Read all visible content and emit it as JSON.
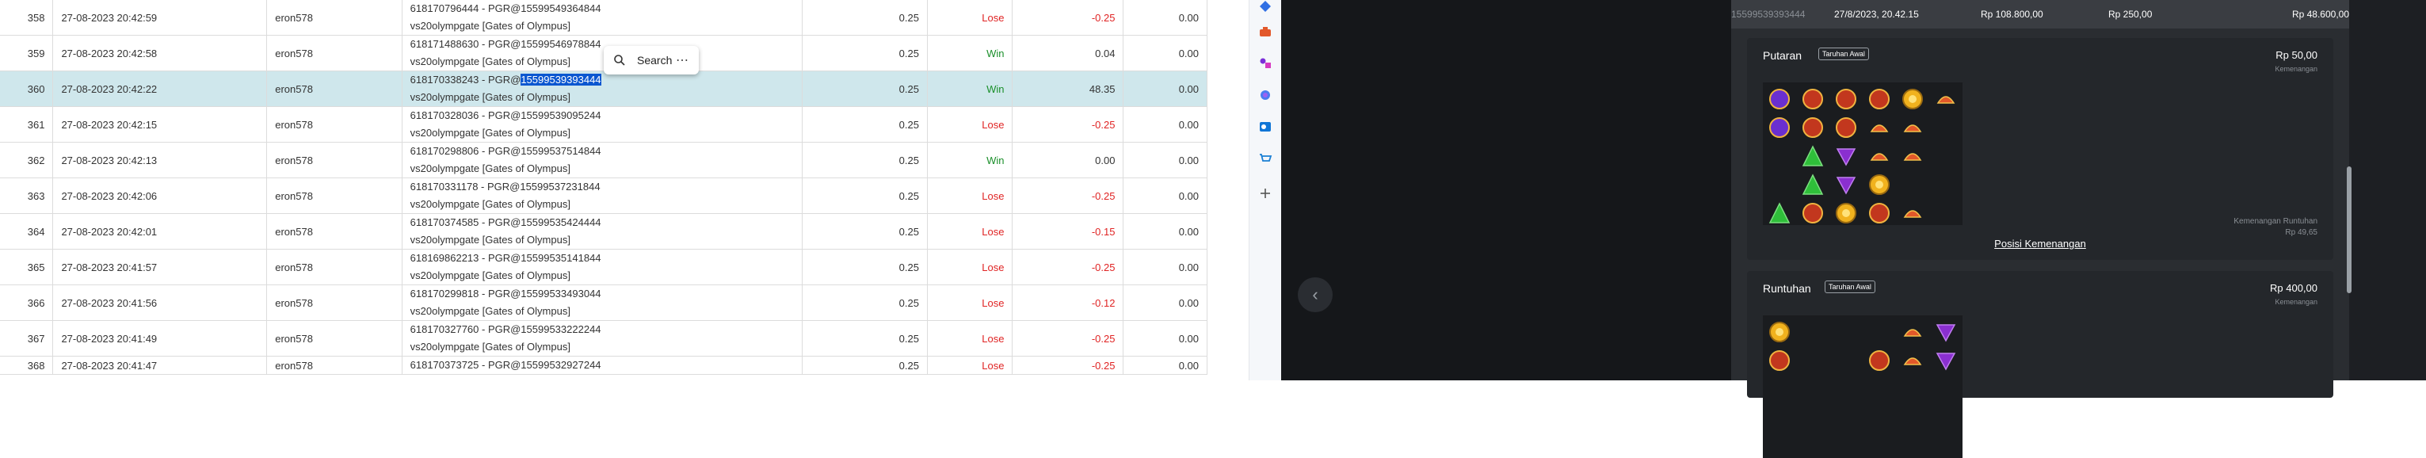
{
  "table": {
    "rows": [
      {
        "no": "358",
        "datetime": "27-08-2023 20:42:59",
        "user": "eron578",
        "tx_line1": "618170796444 - PGR@15599549364844",
        "tx_line2": "vs20olympgate [Gates of Olympus]",
        "bet": "0.25",
        "result": "Lose",
        "winloss": "-0.25",
        "extra": "0.00"
      },
      {
        "no": "359",
        "datetime": "27-08-2023 20:42:58",
        "user": "eron578",
        "tx_line1": "618171488630 - PGR@15599546978844",
        "tx_line2": "vs20olympgate [Gates of Olympus]",
        "bet": "0.25",
        "result": "Win",
        "winloss": "0.04",
        "extra": "0.00"
      },
      {
        "no": "360",
        "datetime": "27-08-2023 20:42:22",
        "user": "eron578",
        "tx_prefix": "618170338243 - PGR@",
        "tx_highlight": "15599539393444",
        "tx_line2": "vs20olympgate [Gates of Olympus]",
        "bet": "0.25",
        "result": "Win",
        "winloss": "48.35",
        "extra": "0.00"
      },
      {
        "no": "361",
        "datetime": "27-08-2023 20:42:15",
        "user": "eron578",
        "tx_line1": "618170328036 - PGR@15599539095244",
        "tx_line2": "vs20olympgate [Gates of Olympus]",
        "bet": "0.25",
        "result": "Lose",
        "winloss": "-0.25",
        "extra": "0.00"
      },
      {
        "no": "362",
        "datetime": "27-08-2023 20:42:13",
        "user": "eron578",
        "tx_line1": "618170298806 - PGR@15599537514844",
        "tx_line2": "vs20olympgate [Gates of Olympus]",
        "bet": "0.25",
        "result": "Win",
        "winloss": "0.00",
        "extra": "0.00"
      },
      {
        "no": "363",
        "datetime": "27-08-2023 20:42:06",
        "user": "eron578",
        "tx_line1": "618170331178 - PGR@15599537231844",
        "tx_line2": "vs20olympgate [Gates of Olympus]",
        "bet": "0.25",
        "result": "Lose",
        "winloss": "-0.25",
        "extra": "0.00"
      },
      {
        "no": "364",
        "datetime": "27-08-2023 20:42:01",
        "user": "eron578",
        "tx_line1": "618170374585 - PGR@15599535424444",
        "tx_line2": "vs20olympgate [Gates of Olympus]",
        "bet": "0.25",
        "result": "Lose",
        "winloss": "-0.15",
        "extra": "0.00"
      },
      {
        "no": "365",
        "datetime": "27-08-2023 20:41:57",
        "user": "eron578",
        "tx_line1": "618169862213 - PGR@15599535141844",
        "tx_line2": "vs20olympgate [Gates of Olympus]",
        "bet": "0.25",
        "result": "Lose",
        "winloss": "-0.25",
        "extra": "0.00"
      },
      {
        "no": "366",
        "datetime": "27-08-2023 20:41:56",
        "user": "eron578",
        "tx_line1": "618170299818 - PGR@15599533493044",
        "tx_line2": "vs20olympgate [Gates of Olympus]",
        "bet": "0.25",
        "result": "Lose",
        "winloss": "-0.12",
        "extra": "0.00"
      },
      {
        "no": "367",
        "datetime": "27-08-2023 20:41:49",
        "user": "eron578",
        "tx_line1": "618170327760 - PGR@15599533222244",
        "tx_line2": "vs20olympgate [Gates of Olympus]",
        "bet": "0.25",
        "result": "Lose",
        "winloss": "-0.25",
        "extra": "0.00"
      },
      {
        "no": "368",
        "datetime": "27-08-2023 20:41:47",
        "user": "eron578",
        "tx_line1": "618170373725 - PGR@15599532927244",
        "tx_line2": "",
        "bet": "0.25",
        "result": "Lose",
        "winloss": "-0.25",
        "extra": "0.00"
      }
    ]
  },
  "popup": {
    "search_label": "Search",
    "more_label": "⋯",
    "icons": [
      "search-icon",
      "more-icon"
    ]
  },
  "sidebar": {
    "icons": [
      "diamond-icon",
      "toolbox-icon",
      "games-icon",
      "copilot-icon",
      "outlook-icon",
      "shopping-icon",
      "add-icon"
    ]
  },
  "detail": {
    "header": {
      "id": "15599539393444",
      "date": "27/8/2023, 20.42.15",
      "bet": "Rp 108.800,00",
      "win": "Rp 250,00",
      "balance": "Rp 48.600,00"
    },
    "putaran": {
      "title": "Putaran",
      "badge": "Taruhan Awal",
      "amount": "Rp 50,00",
      "sub": "Kemenangan"
    },
    "position_link": "Posisi Kemenangan",
    "tumble_label": "Kemenangan Runtuhan",
    "tumble_value": "Rp 49,65",
    "runtuhan": {
      "title": "Runtuhan",
      "badge": "Taruhan Awal",
      "amount": "Rp 400,00",
      "sub": "Kemenangan"
    }
  },
  "colors": {
    "lose": "#e02424",
    "win": "#1a8f2a",
    "selected_row": "#cfe7ec",
    "highlight": "#0b57d0",
    "panel_bg": "#2a2d31"
  }
}
